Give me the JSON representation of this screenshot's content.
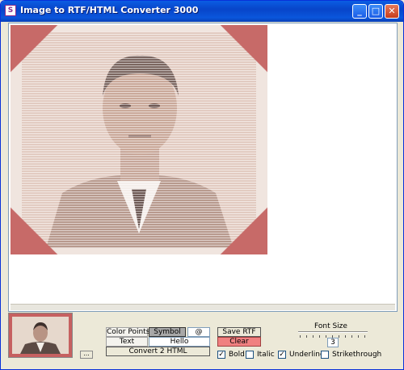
{
  "window": {
    "title": "Image to RTF/HTML Converter 3000",
    "minimize_glyph": "_",
    "maximize_glyph": "□",
    "close_glyph": "✕"
  },
  "controls": {
    "color_points_label": "Color Points",
    "symbol_label": "Symbol",
    "symbol_value": "@",
    "text_label": "Text",
    "text_value": "Hello",
    "convert_html_label": "Convert 2 HTML",
    "save_rtf_label": "Save RTF",
    "clear_label": "Clear",
    "browse_label": "...",
    "font_size_label": "Font Size",
    "font_size_value": "3",
    "check_mark": "✓"
  },
  "options": {
    "bold": {
      "label": "Bold",
      "checked": true
    },
    "italic": {
      "label": "Italic",
      "checked": false
    },
    "underline": {
      "label": "Underline",
      "checked": true
    },
    "strikethrough": {
      "label": "Strikethrough",
      "checked": false
    }
  },
  "icons": {
    "app": "app-icon",
    "minimize": "minimize-icon",
    "maximize": "maximize-icon",
    "close": "close-icon"
  }
}
